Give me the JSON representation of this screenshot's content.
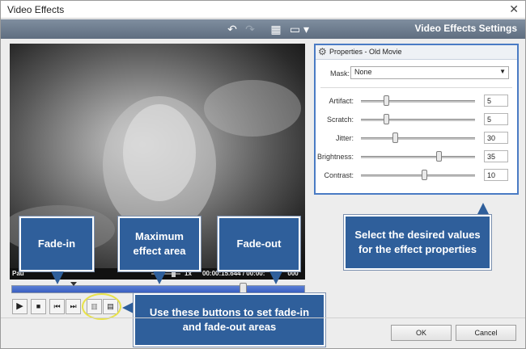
{
  "window": {
    "title": "Video Effects",
    "close_glyph": "✕"
  },
  "toolbar": {
    "title": "Video Effects Settings",
    "icons": [
      "undo-icon",
      "redo-icon",
      "grid-icon",
      "monitor-dropdown-icon"
    ]
  },
  "player": {
    "status": "Pau",
    "speed": "1x",
    "time": "00:00:15.644 / 00:00:",
    "time_tail": "000",
    "controls": [
      "play-icon",
      "stop-icon",
      "prev-icon",
      "next-icon",
      "fade-in-icon",
      "fade-out-icon"
    ]
  },
  "properties": {
    "header": "Properties - Old Movie",
    "mask_label": "Mask:",
    "mask_value": "None",
    "rows": [
      {
        "label": "Artifact:",
        "value": "5",
        "level": 0.22
      },
      {
        "label": "Scratch:",
        "value": "5",
        "level": 0.22
      },
      {
        "label": "Jitter:",
        "value": "30",
        "level": 0.3
      },
      {
        "label": "Brightness:",
        "value": "35",
        "level": 0.68
      },
      {
        "label": "Contrast:",
        "value": "10",
        "level": 0.55
      }
    ]
  },
  "callouts": {
    "fade_in": "Fade-in",
    "max_area": "Maximum effect area",
    "fade_out": "Fade-out",
    "buttons_hint": "Use these buttons to set fade-in and fade-out areas",
    "props_hint": "Select the desired values for the effect properties"
  },
  "footer": {
    "ok": "OK",
    "cancel": "Cancel"
  },
  "colors": {
    "accent": "#2f5f9b",
    "timeline": "#3a5fc0",
    "highlight": "#e8e24a"
  }
}
